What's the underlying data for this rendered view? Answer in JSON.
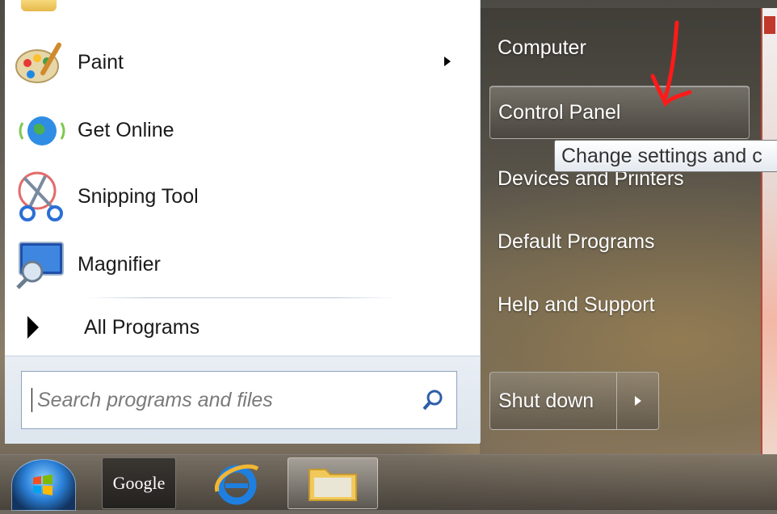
{
  "start_menu": {
    "programs": [
      {
        "label": "Paint",
        "icon": "paint-icon",
        "has_submenu": true
      },
      {
        "label": "Get Online",
        "icon": "globe-icon",
        "has_submenu": false
      },
      {
        "label": "Snipping Tool",
        "icon": "scissors-icon",
        "has_submenu": false
      },
      {
        "label": "Magnifier",
        "icon": "magnifier-icon",
        "has_submenu": false
      }
    ],
    "all_programs_label": "All Programs",
    "search": {
      "placeholder": "Search programs and files",
      "value": ""
    },
    "right_items": [
      {
        "label": "Computer"
      },
      {
        "label": "Control Panel"
      },
      {
        "label": "Devices and Printers"
      },
      {
        "label": "Default Programs"
      },
      {
        "label": "Help and Support"
      }
    ],
    "shutdown_label": "Shut down",
    "tooltip": "Change settings and c"
  },
  "taskbar": {
    "google_label": "Google",
    "items": [
      "start-orb",
      "google-button",
      "internet-explorer-icon",
      "windows-explorer-icon"
    ]
  },
  "annotation": {
    "color": "#ff1a1a"
  }
}
